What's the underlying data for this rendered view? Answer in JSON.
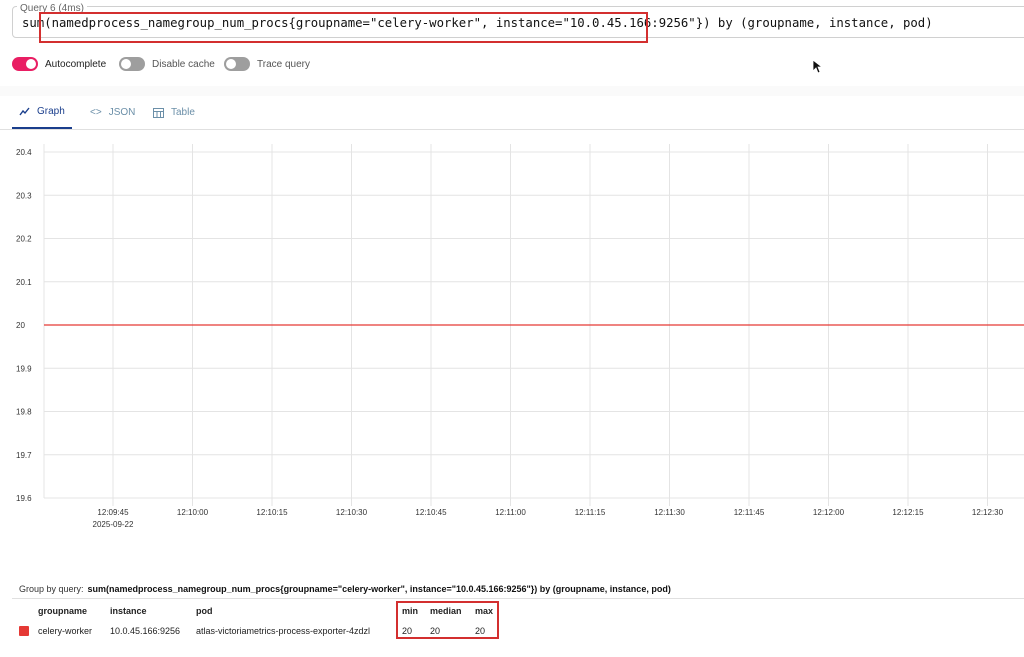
{
  "query": {
    "legend": "Query 6 (4ms)",
    "expression": "sum(namedprocess_namegroup_num_procs{groupname=\"celery-worker\", instance=\"10.0.45.166:9256\"}) by (groupname, instance, pod)"
  },
  "toggles": [
    {
      "label": "Autocomplete",
      "on": true
    },
    {
      "label": "Disable cache",
      "on": false
    },
    {
      "label": "Trace query",
      "on": false
    }
  ],
  "tabs": [
    {
      "label": "Graph",
      "icon": "graph-icon",
      "active": true
    },
    {
      "label": "JSON",
      "icon": "code-icon",
      "active": false
    },
    {
      "label": "Table",
      "icon": "table-icon",
      "active": false
    }
  ],
  "chart_data": {
    "type": "line",
    "x": [
      "12:09:45",
      "12:10:00",
      "12:10:15",
      "12:10:30",
      "12:10:45",
      "12:11:00",
      "12:11:15",
      "12:11:30",
      "12:11:45",
      "12:12:00",
      "12:12:15",
      "12:12:30"
    ],
    "x_date_label": "2025-09-22",
    "y_ticks": [
      "20.4",
      "20.3",
      "20.2",
      "20.1",
      "20",
      "19.9",
      "19.8",
      "19.7",
      "19.6"
    ],
    "ylim": [
      19.6,
      20.4
    ],
    "series": [
      {
        "name": "celery-worker",
        "values": [
          20,
          20,
          20,
          20,
          20,
          20,
          20,
          20,
          20,
          20,
          20,
          20
        ],
        "color": "#e53935"
      }
    ],
    "grid": true
  },
  "legend": {
    "group_by_label": "Group by query:",
    "group_by_query": "sum(namedprocess_namegroup_num_procs{groupname=\"celery-worker\", instance=\"10.0.45.166:9256\"}) by (groupname, instance, pod)",
    "columns": [
      "groupname",
      "instance",
      "pod",
      "min",
      "median",
      "max"
    ],
    "rows": [
      {
        "groupname": "celery-worker",
        "instance": "10.0.45.166:9256",
        "pod": "atlas-victoriametrics-process-exporter-4zdzl",
        "min": "20",
        "median": "20",
        "max": "20",
        "color": "#e53935"
      }
    ]
  }
}
